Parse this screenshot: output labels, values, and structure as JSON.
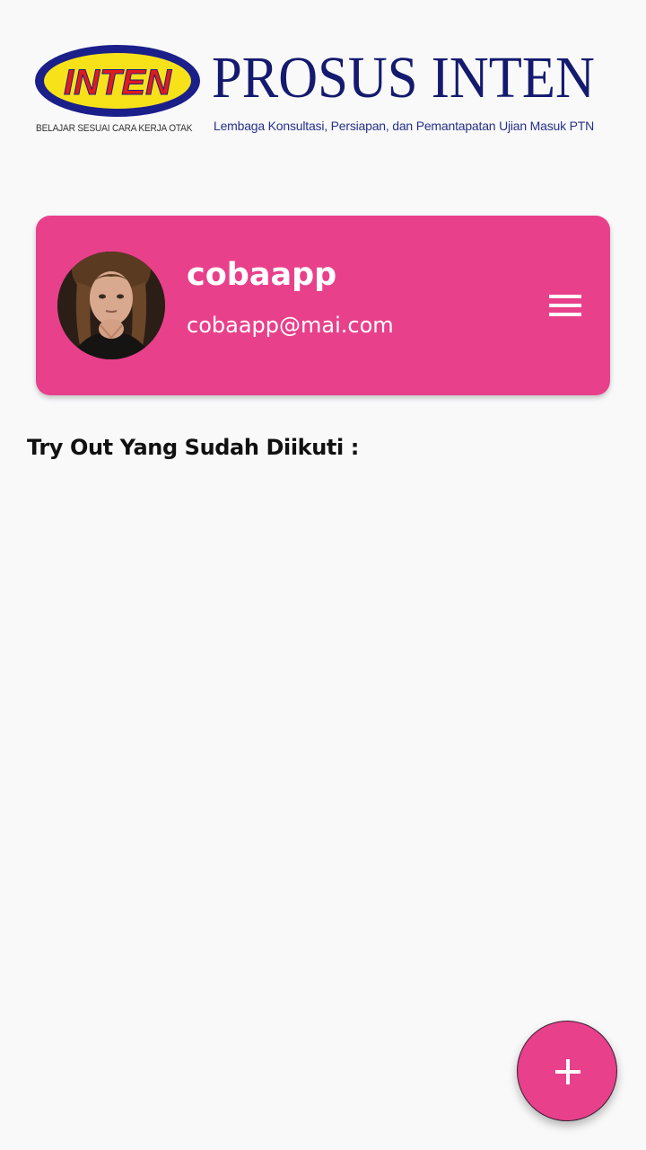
{
  "header": {
    "logo_text": "INTEN",
    "tagline": "BELAJAR SESUAI CARA KERJA OTAK",
    "title": "PROSUS INTEN",
    "subtitle": "Lembaga Konsultasi, Persiapan, dan Pemantapatan Ujian Masuk PTN",
    "logo_colors": {
      "ring": "#1b1f8a",
      "fill": "#f7e21a",
      "letters": "#e01b1b"
    }
  },
  "profile": {
    "name": "cobaapp",
    "email": "cobaapp@mai.com",
    "avatar_icon": "user-photo",
    "menu_icon": "hamburger-menu-icon",
    "card_color": "#e8408b"
  },
  "tryouts": {
    "heading": "Try Out Yang Sudah Diikuti :",
    "items": []
  },
  "fab": {
    "icon": "plus-icon",
    "color": "#e8408b"
  }
}
